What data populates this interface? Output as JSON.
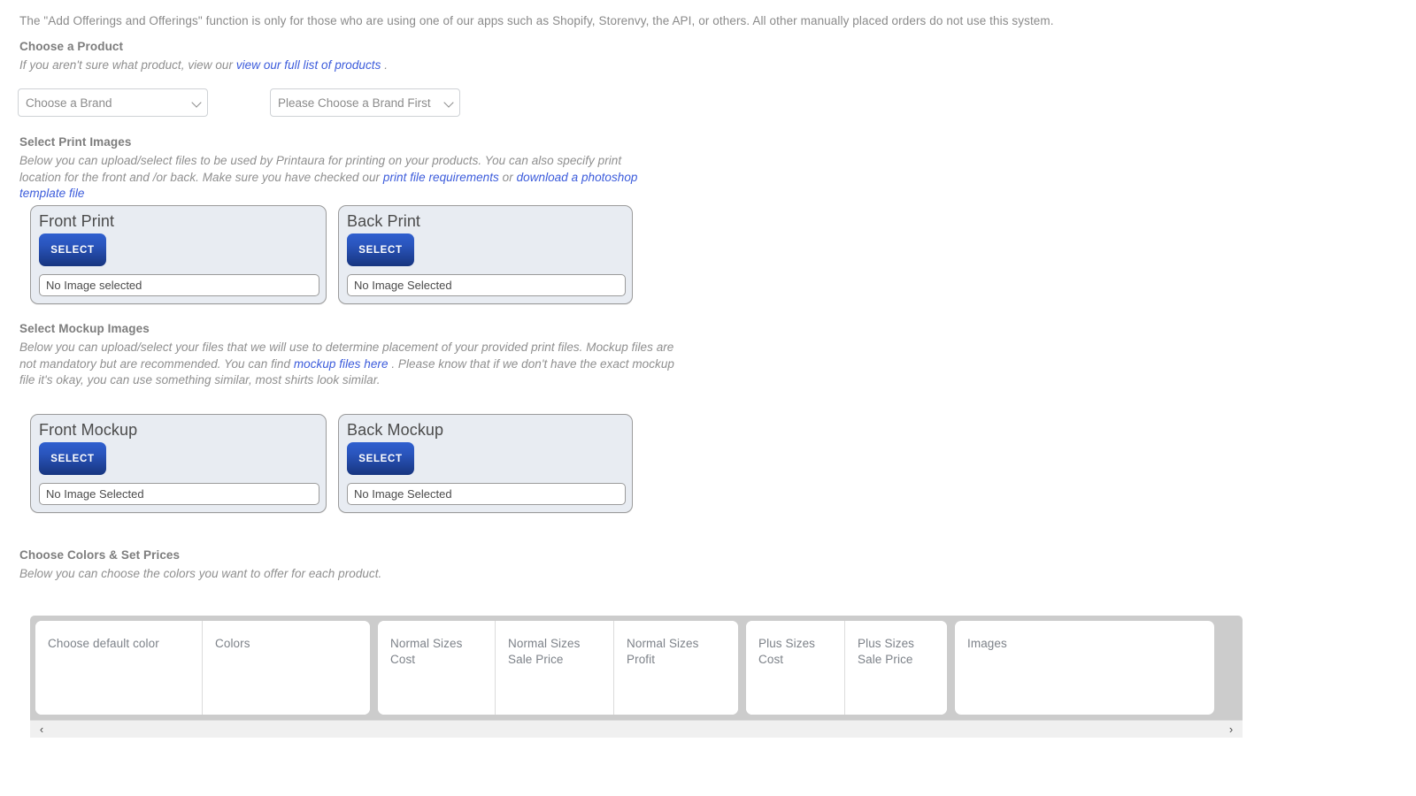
{
  "intro": {
    "notice": "The \"Add Offerings and Offerings\" function is only for those who are using one of our apps such as Shopify, Storenvy, the API, or others. All other manually placed orders do not use this system."
  },
  "product": {
    "title": "Choose a Product",
    "subtitle_before": "If you aren't sure what product, view our",
    "link_text": "view our full list of products",
    "subtitle_after": ".",
    "brand_select": {
      "selected": "Choose a Brand",
      "options": [
        "Choose a Brand"
      ]
    },
    "product_select": {
      "selected": "Please Choose a Brand First",
      "options": [
        "Please Choose a Brand First"
      ]
    }
  },
  "print_images": {
    "title": "Select Print Images",
    "desc_part1": "Below you can upload/select files to be used by Printaura for printing on your products. You can also specify print location for the front and /or back. Make sure you have checked our",
    "link1": "print file requirements",
    "desc_mid": "or",
    "link2": "download a photoshop template file",
    "cards": [
      {
        "title": "Front Print",
        "button": "SELECT",
        "file_value": "No Image selected"
      },
      {
        "title": "Back Print",
        "button": "SELECT",
        "file_value": "No Image Selected"
      }
    ]
  },
  "mockup_images": {
    "title": "Select Mockup Images",
    "desc_part1": "Below you can upload/select your files that we will use to determine placement of your provided print files. Mockup files are not mandatory but are recommended. You can find",
    "link1": "mockup files here",
    "desc_part2": ". Please know that if we don't have the exact mockup file it's okay, you can use something similar, most shirts look similar.",
    "cards": [
      {
        "title": "Front Mockup",
        "button": "SELECT",
        "file_value": "No Image Selected"
      },
      {
        "title": "Back Mockup",
        "button": "SELECT",
        "file_value": "No Image Selected"
      }
    ]
  },
  "colors_prices": {
    "title": "Choose Colors & Set Prices",
    "subtitle": "Below you can choose the colors you want to offer for each product.",
    "table": {
      "columns": [
        {
          "id": "default-color",
          "line1": "Choose default color",
          "line2": ""
        },
        {
          "id": "colors",
          "line1": "Colors",
          "line2": ""
        },
        {
          "id": "normal-sizes-cost",
          "line1": "Normal Sizes",
          "line2": "Cost"
        },
        {
          "id": "normal-sizes-sale-price",
          "line1": "Normal Sizes",
          "line2": "Sale Price"
        },
        {
          "id": "normal-sizes-profit",
          "line1": "Normal Sizes",
          "line2": "Profit"
        },
        {
          "id": "plus-sizes-cost",
          "line1": "Plus Sizes",
          "line2": "Cost"
        },
        {
          "id": "plus-sizes-sale-price",
          "line1": "Plus Sizes",
          "line2": "Sale Price"
        },
        {
          "id": "images",
          "line1": "Images",
          "line2": ""
        }
      ],
      "rows": []
    },
    "scrollbar": {
      "left_arrow": "‹",
      "right_arrow": "›"
    }
  },
  "colors": {
    "link": "#3b5bdb",
    "heading": "#7d7d7d",
    "body_text": "#8f8f8f",
    "button_top": "#2f5fcf",
    "button_bottom": "#17357f",
    "card_bg": "#e8ecf2",
    "table_bg": "#cccccc"
  }
}
